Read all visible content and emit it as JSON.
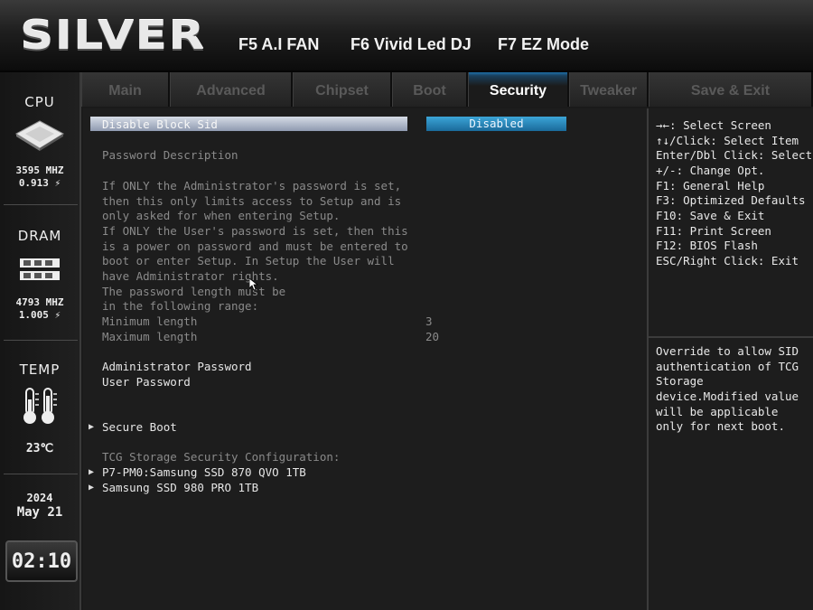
{
  "header": {
    "logo": "SILVER",
    "fkeys": [
      "F5 A.I FAN",
      "F6 Vivid Led DJ",
      "F7 EZ Mode"
    ]
  },
  "tabs": [
    {
      "label": "Main",
      "active": false
    },
    {
      "label": "Advanced",
      "active": false
    },
    {
      "label": "Chipset",
      "active": false
    },
    {
      "label": "Boot",
      "active": false
    },
    {
      "label": "Security",
      "active": true
    },
    {
      "label": "Tweaker",
      "active": false
    },
    {
      "label": "Save & Exit",
      "active": false
    }
  ],
  "sidebar": {
    "cpu": {
      "title": "CPU",
      "freq": "3595 MHZ",
      "volt": "0.913 ⚡"
    },
    "dram": {
      "title": "DRAM",
      "freq": "4793 MHZ",
      "volt": "1.005 ⚡"
    },
    "temp": {
      "title": "TEMP",
      "value": "23℃"
    },
    "date": {
      "year": "2024",
      "monthday": "May 21"
    },
    "clock": "02:10"
  },
  "main": {
    "selected_item": {
      "label": "Disable Block Sid",
      "value": "Disabled"
    },
    "description_title": "Password Description",
    "description_lines": [
      "If ONLY the Administrator's password is set,",
      "then this only limits access to Setup and is",
      "only asked for when entering Setup.",
      "If ONLY the User's password is set, then this",
      "is a power on password and must be entered to",
      "boot or enter Setup. In Setup the User will",
      "have Administrator rights.",
      "The password length must be",
      "in the following range:"
    ],
    "min_length": {
      "label": "Minimum length",
      "value": "3"
    },
    "max_length": {
      "label": "Maximum length",
      "value": "20"
    },
    "admin_password": "Administrator Password",
    "user_password": "User Password",
    "secure_boot": "Secure Boot",
    "tcg_title": "TCG Storage Security Configuration:",
    "drives": [
      "P7-PM0:Samsung SSD 870 QVO 1TB",
      "Samsung SSD 980 PRO 1TB"
    ]
  },
  "help": {
    "keys": [
      "→←: Select Screen",
      "↑↓/Click: Select Item",
      "Enter/Dbl Click: Select",
      "+/-: Change Opt.",
      "F1: General Help",
      "F3: Optimized Defaults",
      "F10: Save & Exit",
      "F11: Print Screen",
      "F12: BIOS Flash",
      "ESC/Right Click: Exit"
    ],
    "item_help": [
      "Override to allow SID",
      "authentication of TCG",
      "Storage",
      "device.Modified value",
      "will be applicable",
      "only for next boot."
    ]
  },
  "colors": {
    "accent": "#2a8fc6",
    "selected_bar": "#b8c0d0"
  }
}
